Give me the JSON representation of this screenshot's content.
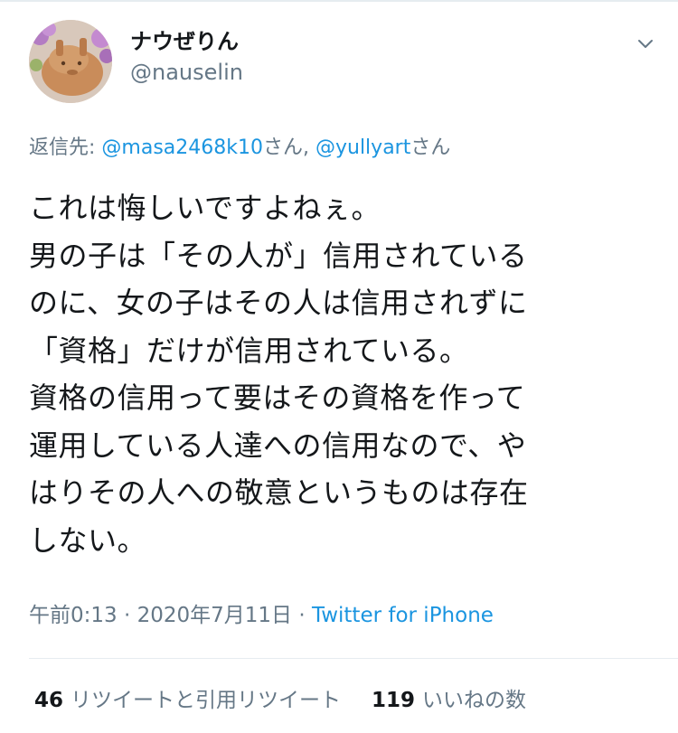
{
  "user": {
    "display_name": "ナウぜりん",
    "handle": "@nauselin"
  },
  "reply": {
    "prefix": "返信先: ",
    "mention_1": "@masa2468k10",
    "suffix_1": "さん, ",
    "mention_2": "@yullyart",
    "suffix_2": "さん"
  },
  "tweet": {
    "text": "これは悔しいですよねぇ。\n男の子は「その人が」信用されている\nのに、女の子はその人は信用されずに\n「資格」だけが信用されている。\n資格の信用って要はその資格を作って\n運用している人達への信用なので、や\nはりその人への敬意というものは存在\nしない。"
  },
  "meta": {
    "time": "午前0:13",
    "separator": " · ",
    "date": "2020年7月11日",
    "source": "Twitter for iPhone"
  },
  "stats": {
    "retweets_count": "46",
    "retweets_label": "リツイートと引用リツイート",
    "likes_count": "119",
    "likes_label": "いいねの数"
  },
  "icons": {
    "menu": "chevron-down-icon",
    "avatar": "avatar"
  },
  "colors": {
    "link": "#1b95e0",
    "secondary_text": "#657786",
    "primary_text": "#14171a",
    "divider": "#e6ecf0"
  }
}
